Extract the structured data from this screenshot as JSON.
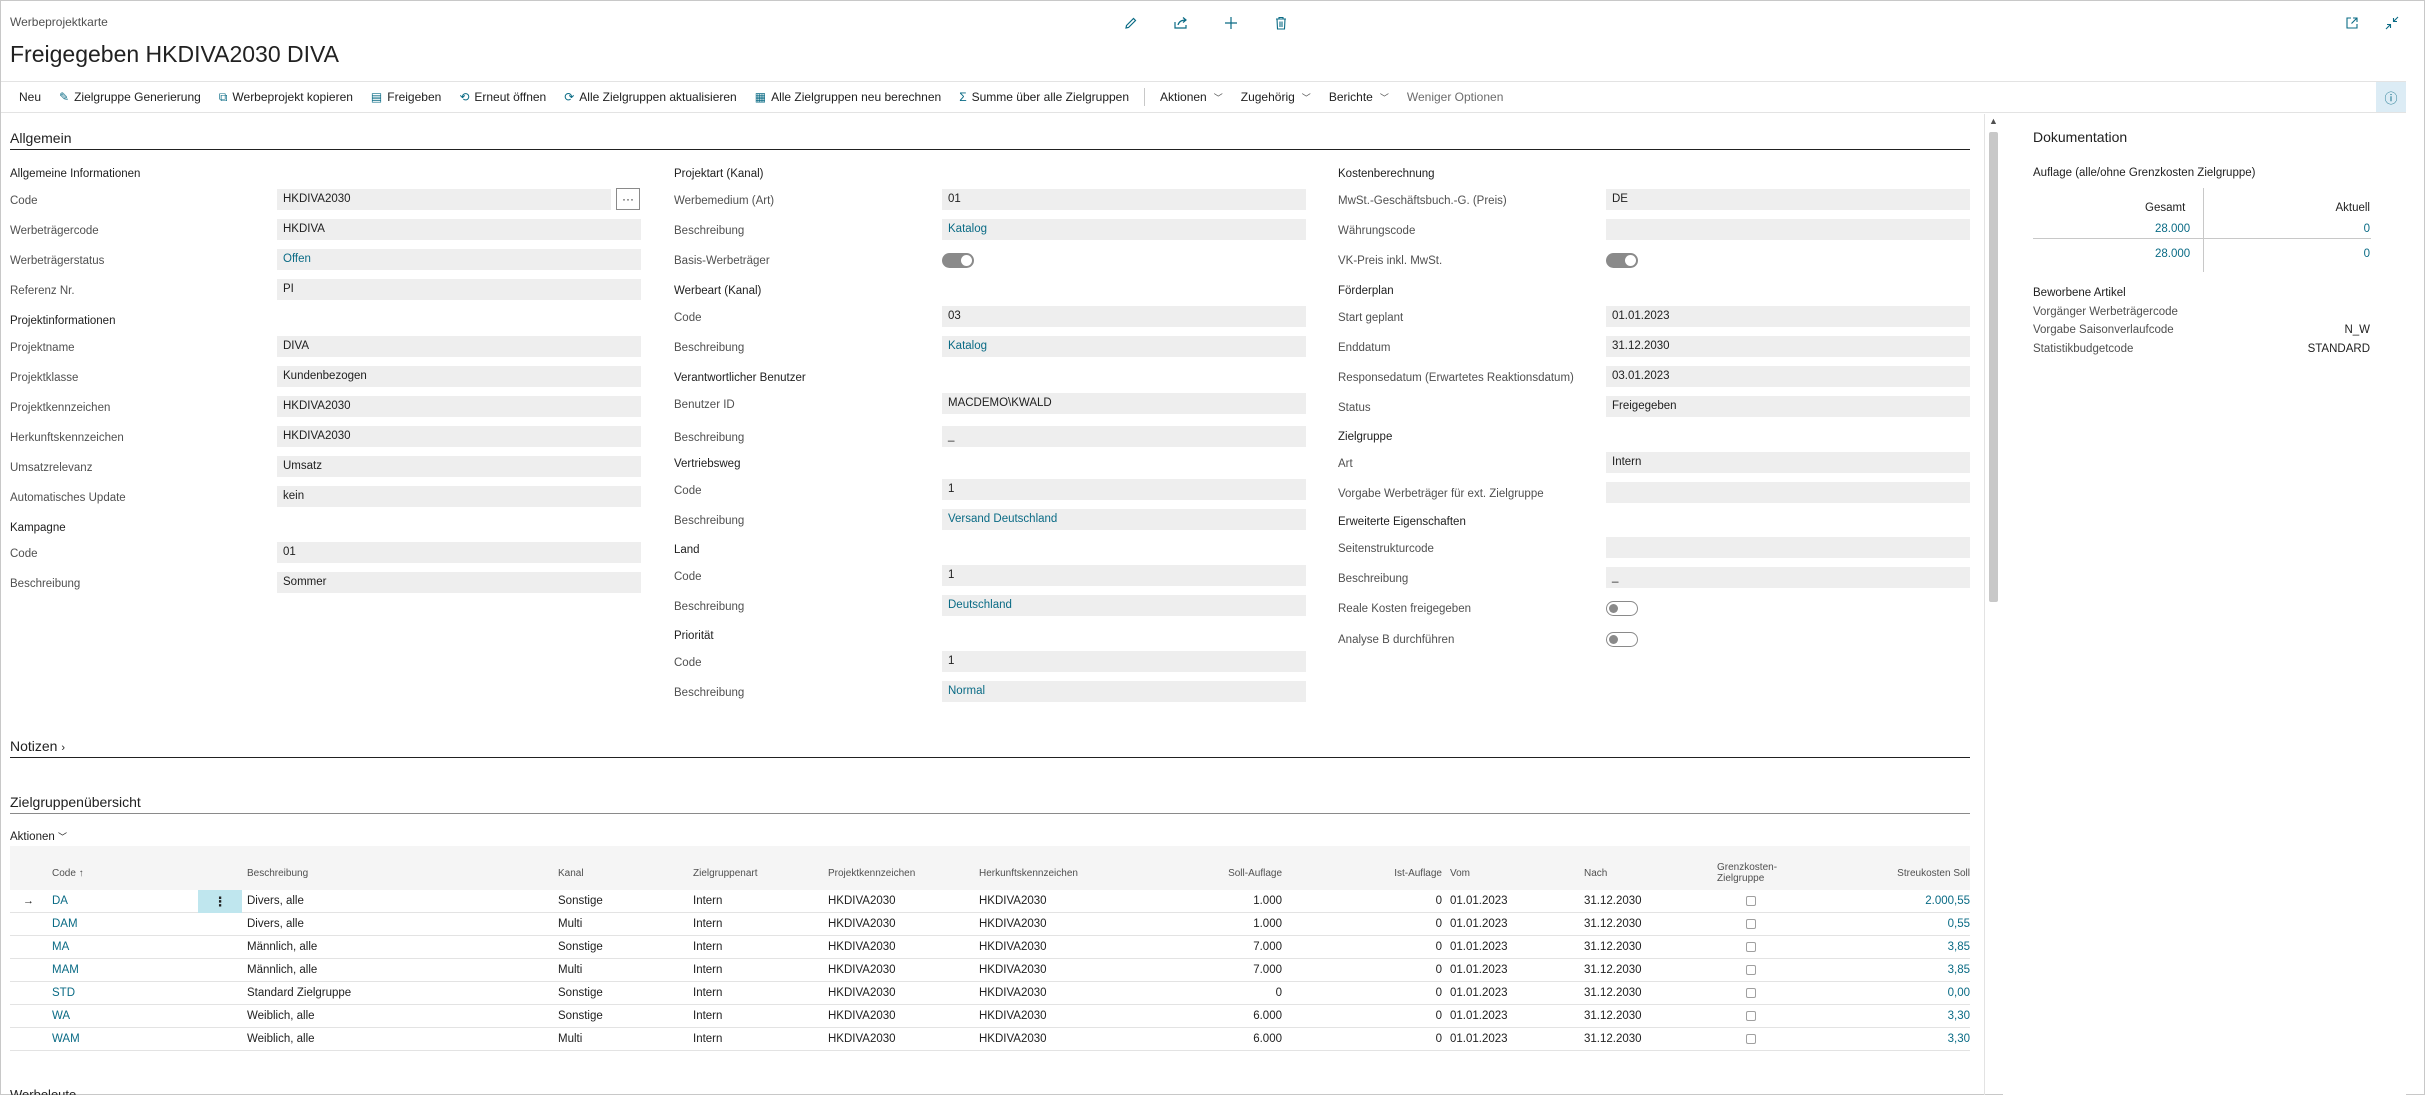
{
  "header": {
    "caption": "Werbeprojektkarte",
    "title": "Freigegeben HKDIVA2030 DIVA"
  },
  "actions": {
    "neu": "Neu",
    "zielgruppe_generierung": "Zielgruppe Generierung",
    "werbeprojekt_kopieren": "Werbeprojekt kopieren",
    "freigeben": "Freigeben",
    "erneut_oeffnen": "Erneut öffnen",
    "alle_aktualisieren": "Alle Zielgruppen aktualisieren",
    "alle_neu_berechnen": "Alle Zielgruppen neu berechnen",
    "summe": "Summe über alle Zielgruppen",
    "aktionen": "Aktionen",
    "zugehoerig": "Zugehörig",
    "berichte": "Berichte",
    "weniger": "Weniger Optionen"
  },
  "allgemein": {
    "title": "Allgemein",
    "col1": {
      "g1": "Allgemeine Informationen",
      "code_l": "Code",
      "code_v": "HKDIVA2030",
      "wtc_l": "Werbeträgercode",
      "wtc_v": "HKDIVA",
      "wts_l": "Werbeträgerstatus",
      "wts_v": "Offen",
      "ref_l": "Referenz Nr.",
      "ref_v": "PI",
      "g2": "Projektinformationen",
      "pname_l": "Projektname",
      "pname_v": "DIVA",
      "pklasse_l": "Projektklasse",
      "pklasse_v": "Kundenbezogen",
      "pkz_l": "Projektkennzeichen",
      "pkz_v": "HKDIVA2030",
      "hkz_l": "Herkunftskennzeichen",
      "hkz_v": "HKDIVA2030",
      "umsatz_l": "Umsatzrelevanz",
      "umsatz_v": "Umsatz",
      "auto_l": "Automatisches Update",
      "auto_v": "kein",
      "g3": "Kampagne",
      "kcode_l": "Code",
      "kcode_v": "01",
      "kbes_l": "Beschreibung",
      "kbes_v": "Sommer"
    },
    "col2": {
      "g1": "Projektart (Kanal)",
      "wm_l": "Werbemedium (Art)",
      "wm_v": "01",
      "b1_l": "Beschreibung",
      "b1_v": "Katalog",
      "basis_l": "Basis-Werbeträger",
      "g2": "Werbeart (Kanal)",
      "c2_l": "Code",
      "c2_v": "03",
      "b2_l": "Beschreibung",
      "b2_v": "Katalog",
      "g3": "Verantwortlicher Benutzer",
      "uid_l": "Benutzer ID",
      "uid_v": "MACDEMO\\KWALD",
      "b3_l": "Beschreibung",
      "b3_v": "_",
      "g4": "Vertriebsweg",
      "c4_l": "Code",
      "c4_v": "1",
      "b4_l": "Beschreibung",
      "b4_v": "Versand Deutschland",
      "g5": "Land",
      "c5_l": "Code",
      "c5_v": "1",
      "b5_l": "Beschreibung",
      "b5_v": "Deutschland",
      "g6": "Priorität",
      "c6_l": "Code",
      "c6_v": "1",
      "b6_l": "Beschreibung",
      "b6_v": "Normal"
    },
    "col3": {
      "g1": "Kostenberechnung",
      "mwst_l": "MwSt.-Geschäftsbuch.-G. (Preis)",
      "mwst_v": "DE",
      "wc_l": "Währungscode",
      "wc_v": "",
      "vk_l": "VK-Preis inkl. MwSt.",
      "g2": "Förderplan",
      "start_l": "Start geplant",
      "start_v": "01.01.2023",
      "end_l": "Enddatum",
      "end_v": "31.12.2030",
      "resp_l": "Responsedatum (Erwartetes Reaktionsdatum)",
      "resp_v": "03.01.2023",
      "status_l": "Status",
      "status_v": "Freigegeben",
      "g3": "Zielgruppe",
      "art_l": "Art",
      "art_v": "Intern",
      "vorg_l": "Vorgabe Werbeträger für ext. Zielgruppe",
      "vorg_v": "",
      "g4": "Erweiterte Eigenschaften",
      "ssc_l": "Seitenstrukturcode",
      "ssc_v": "",
      "bes_l": "Beschreibung",
      "bes_v": "_",
      "real_l": "Reale Kosten freigegeben",
      "anal_l": "Analyse B durchführen"
    }
  },
  "notizen": {
    "title": "Notizen"
  },
  "zielgruppen": {
    "title": "Zielgruppenübersicht",
    "aktionen": "Aktionen",
    "headers": {
      "code": "Code ↑",
      "beschreibung": "Beschreibung",
      "kanal": "Kanal",
      "zgart": "Zielgruppenart",
      "pkz": "Projektkennzeichen",
      "hkz": "Herkunftskennzeichen",
      "soll": "Soll-Auflage",
      "ist": "Ist-Auflage",
      "vom": "Vom",
      "nach": "Nach",
      "grenz1": "Grenzkosten-",
      "grenz2": "Zielgruppe",
      "streu": "Streukosten Soll"
    },
    "rows": [
      {
        "code": "DA",
        "beschreibung": "Divers, alle",
        "kanal": "Sonstige",
        "zgart": "Intern",
        "pkz": "HKDIVA2030",
        "hkz": "HKDIVA2030",
        "soll": "1.000",
        "ist": "0",
        "vom": "01.01.2023",
        "nach": "31.12.2030",
        "streu": "2.000,55"
      },
      {
        "code": "DAM",
        "beschreibung": "Divers, alle",
        "kanal": "Multi",
        "zgart": "Intern",
        "pkz": "HKDIVA2030",
        "hkz": "HKDIVA2030",
        "soll": "1.000",
        "ist": "0",
        "vom": "01.01.2023",
        "nach": "31.12.2030",
        "streu": "0,55"
      },
      {
        "code": "MA",
        "beschreibung": "Männlich, alle",
        "kanal": "Sonstige",
        "zgart": "Intern",
        "pkz": "HKDIVA2030",
        "hkz": "HKDIVA2030",
        "soll": "7.000",
        "ist": "0",
        "vom": "01.01.2023",
        "nach": "31.12.2030",
        "streu": "3,85"
      },
      {
        "code": "MAM",
        "beschreibung": "Männlich, alle",
        "kanal": "Multi",
        "zgart": "Intern",
        "pkz": "HKDIVA2030",
        "hkz": "HKDIVA2030",
        "soll": "7.000",
        "ist": "0",
        "vom": "01.01.2023",
        "nach": "31.12.2030",
        "streu": "3,85"
      },
      {
        "code": "STD",
        "beschreibung": "Standard Zielgruppe",
        "kanal": "Sonstige",
        "zgart": "Intern",
        "pkz": "HKDIVA2030",
        "hkz": "HKDIVA2030",
        "soll": "0",
        "ist": "0",
        "vom": "01.01.2023",
        "nach": "31.12.2030",
        "streu": "0,00"
      },
      {
        "code": "WA",
        "beschreibung": "Weiblich, alle",
        "kanal": "Sonstige",
        "zgart": "Intern",
        "pkz": "HKDIVA2030",
        "hkz": "HKDIVA2030",
        "soll": "6.000",
        "ist": "0",
        "vom": "01.01.2023",
        "nach": "31.12.2030",
        "streu": "3,30"
      },
      {
        "code": "WAM",
        "beschreibung": "Weiblich, alle",
        "kanal": "Multi",
        "zgart": "Intern",
        "pkz": "HKDIVA2030",
        "hkz": "HKDIVA2030",
        "soll": "6.000",
        "ist": "0",
        "vom": "01.01.2023",
        "nach": "31.12.2030",
        "streu": "3,30"
      }
    ],
    "next_section": "Werbeleute"
  },
  "factbox": {
    "title": "Dokumentation",
    "subtitle": "Auflage (alle/ohne Grenzkosten Zielgruppe)",
    "gesamt_h": "Gesamt",
    "aktuell_h": "Aktuell",
    "g1": "28.000",
    "a1": "0",
    "g2": "28.000",
    "a2": "0",
    "group": "Beworbene Artikel",
    "vwc_l": "Vorgänger Werbeträgercode",
    "vwc_v": "",
    "vsc_l": "Vorgabe Saisonverlaufcode",
    "vsc_v": "N_W",
    "sbc_l": "Statistikbudgetcode",
    "sbc_v": "STANDARD"
  },
  "colors": {
    "accent": "#0a6b85",
    "field_bg": "#eeeeee",
    "row_highlight": "#bfe6ee"
  },
  "icons": [
    "edit-icon",
    "share-icon",
    "add-icon",
    "delete-icon",
    "open-new-window-icon",
    "collapse-icon",
    "info-icon"
  ]
}
